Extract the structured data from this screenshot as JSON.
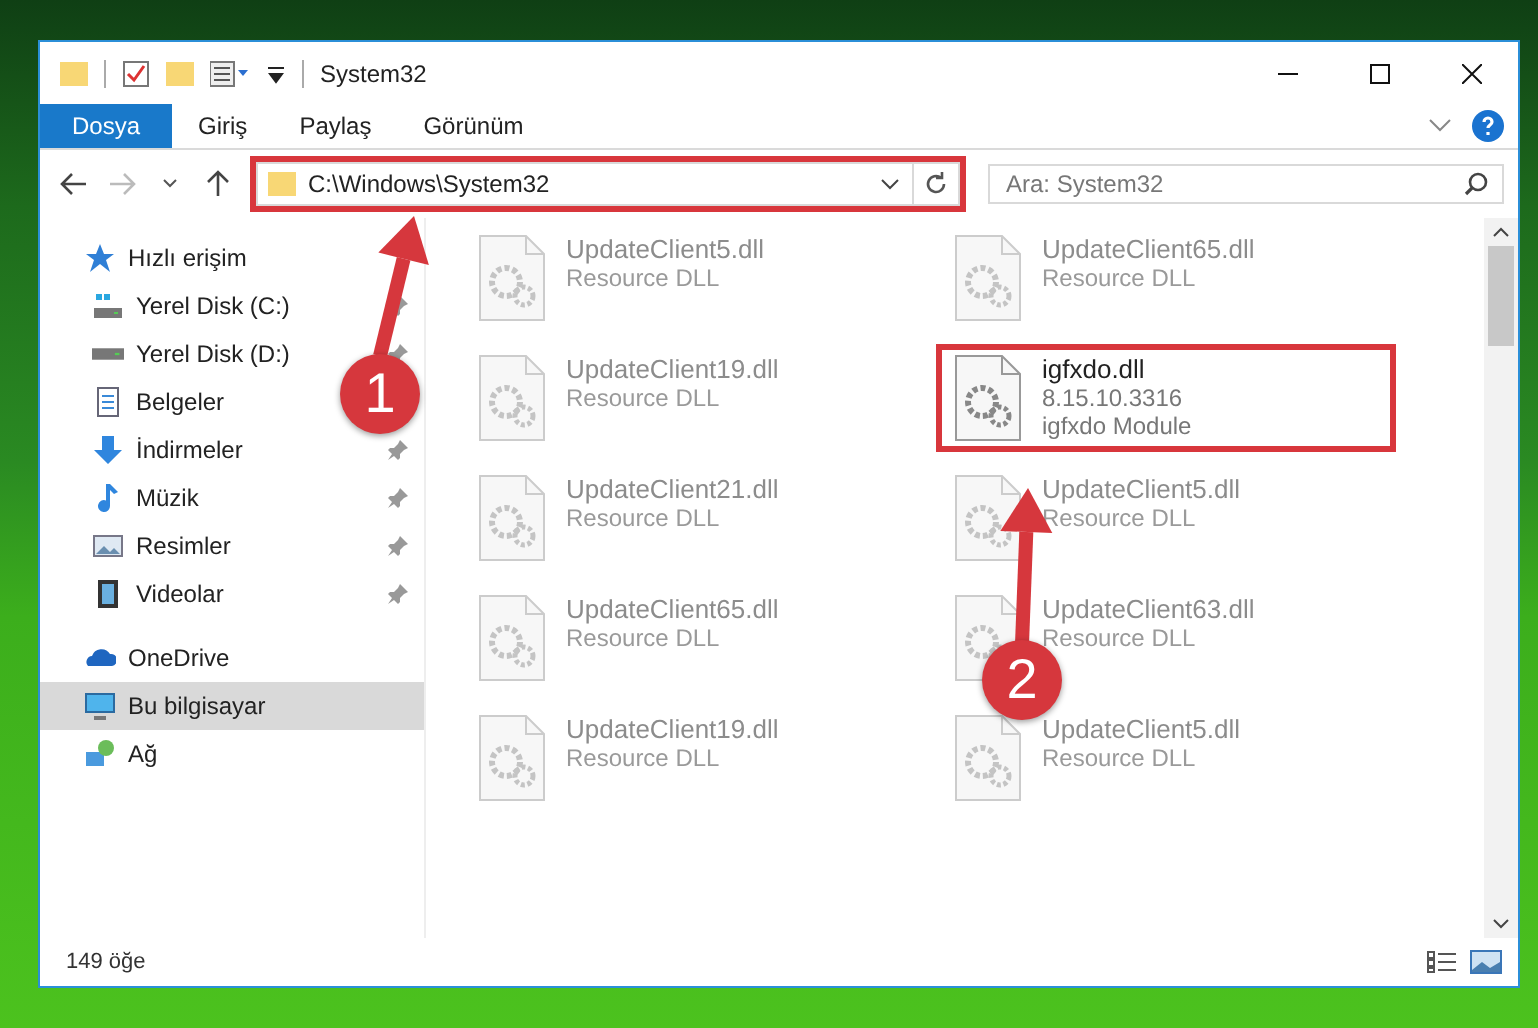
{
  "window": {
    "title": "System32"
  },
  "ribbon_tabs": [
    {
      "label": "Dosya",
      "selected": true
    },
    {
      "label": "Giriş",
      "selected": false
    },
    {
      "label": "Paylaş",
      "selected": false
    },
    {
      "label": "Görünüm",
      "selected": false
    }
  ],
  "address": {
    "path": "C:\\Windows\\System32",
    "highlighted": true
  },
  "search": {
    "placeholder": "Ara: System32"
  },
  "sidebar": {
    "items": [
      {
        "label": "Hızlı erişim",
        "kind": "star",
        "selected": false,
        "children": [
          {
            "label": "Yerel Disk (C:)",
            "kind": "system-drive",
            "pinned": true,
            "selected": false
          },
          {
            "label": "Yerel Disk (D:)",
            "kind": "drive",
            "pinned": true,
            "selected": false
          },
          {
            "label": "Belgeler",
            "kind": "documents",
            "selected": false
          },
          {
            "label": "İndirmeler",
            "kind": "download",
            "pinned": true,
            "selected": false
          },
          {
            "label": "Müzik",
            "kind": "music",
            "pinned": true,
            "selected": false
          },
          {
            "label": "Resimler",
            "kind": "pictures",
            "pinned": true,
            "selected": false
          },
          {
            "label": "Videolar",
            "kind": "videos",
            "pinned": true,
            "selected": false
          }
        ]
      },
      {
        "label": "OneDrive",
        "kind": "cloud",
        "selected": false
      },
      {
        "label": "Bu bilgisayar",
        "kind": "computer",
        "selected": true
      },
      {
        "label": "Ağ",
        "kind": "network",
        "selected": false
      }
    ]
  },
  "files": [
    {
      "name": "UpdateClient5.dll",
      "details": [
        "Resource DLL"
      ],
      "blurred": true,
      "highlighted": false
    },
    {
      "name": "UpdateClient65.dll",
      "details": [
        "Resource DLL"
      ],
      "blurred": true,
      "highlighted": false
    },
    {
      "name": "UpdateClient19.dll",
      "details": [
        "Resource DLL"
      ],
      "blurred": true,
      "highlighted": false
    },
    {
      "name": "igfxdo.dll",
      "details": [
        "8.15.10.3316",
        "igfxdo Module"
      ],
      "blurred": false,
      "highlighted": true
    },
    {
      "name": "UpdateClient21.dll",
      "details": [
        "Resource DLL"
      ],
      "blurred": true,
      "highlighted": false
    },
    {
      "name": "UpdateClient5.dll",
      "details": [
        "Resource DLL"
      ],
      "blurred": true,
      "highlighted": false
    },
    {
      "name": "UpdateClient65.dll",
      "details": [
        "Resource DLL"
      ],
      "blurred": true,
      "highlighted": false
    },
    {
      "name": "UpdateClient63.dll",
      "details": [
        "Resource DLL"
      ],
      "blurred": true,
      "highlighted": false
    },
    {
      "name": "UpdateClient19.dll",
      "details": [
        "Resource DLL"
      ],
      "blurred": true,
      "highlighted": false
    },
    {
      "name": "UpdateClient5.dll",
      "details": [
        "Resource DLL"
      ],
      "blurred": true,
      "highlighted": false
    }
  ],
  "status_bar": {
    "item_count": "149 öğe"
  },
  "annotations": [
    {
      "label": "1"
    },
    {
      "label": "2"
    }
  ]
}
